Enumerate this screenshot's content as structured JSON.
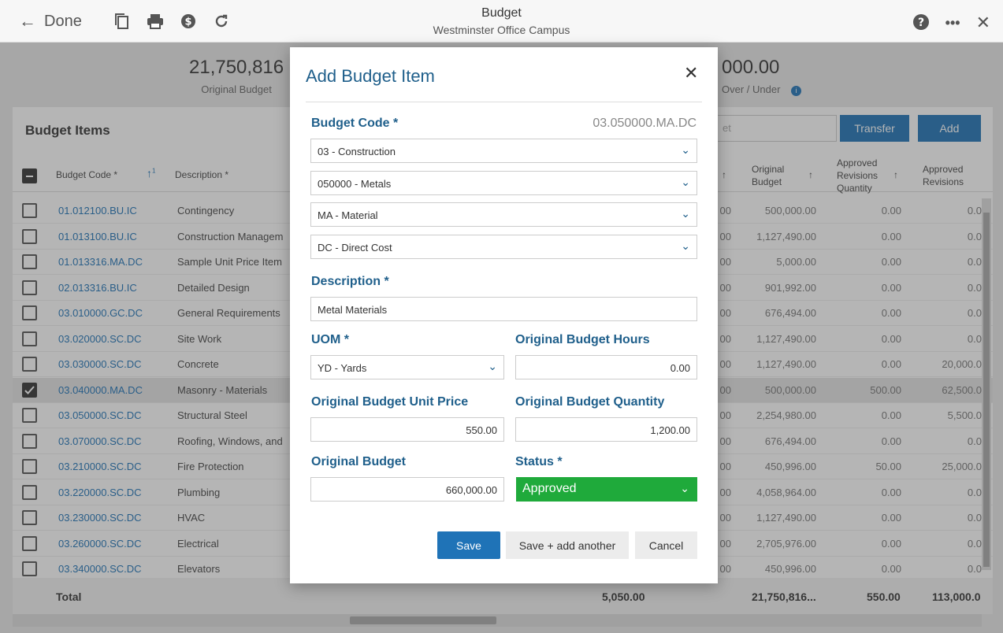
{
  "topbar": {
    "back_label": "Done",
    "title": "Budget",
    "subtitle": "Westminster Office Campus",
    "icons": [
      "copy-icon",
      "print-icon",
      "dollar-icon",
      "refresh-icon",
      "help-icon",
      "more-icon",
      "close-icon"
    ]
  },
  "summary": {
    "original_budget_value": "21,750,816",
    "original_budget_label": "Original Budget",
    "over_under_value": "000.00",
    "over_under_label": "Over / Under"
  },
  "panel": {
    "title": "Budget Items",
    "search_placeholder": "et",
    "transfer_label": "Transfer",
    "add_label": "Add",
    "columns": {
      "budget_code": "Budget Code *",
      "sort_number": "1",
      "description": "Description *",
      "original_budget": "Original Budget",
      "approved_revisions_qty": "Approved Revisions Quantity",
      "approved_revisions": "Approved Revisions"
    },
    "rows": [
      {
        "code": "01.012100.BU.IC",
        "desc": "Contingency",
        "c1": "00",
        "c2": "500,000.00",
        "c3": "0.00",
        "c4": "0.0"
      },
      {
        "code": "01.013100.BU.IC",
        "desc": "Construction Managem",
        "c1": "00",
        "c2": "1,127,490.00",
        "c3": "0.00",
        "c4": "0.0"
      },
      {
        "code": "01.013316.MA.DC",
        "desc": "Sample Unit Price Item",
        "c1": "00",
        "c2": "5,000.00",
        "c3": "0.00",
        "c4": "0.0"
      },
      {
        "code": "02.013316.BU.IC",
        "desc": "Detailed Design",
        "c1": "00",
        "c2": "901,992.00",
        "c3": "0.00",
        "c4": "0.0"
      },
      {
        "code": "03.010000.GC.DC",
        "desc": "General Requirements",
        "c1": "00",
        "c2": "676,494.00",
        "c3": "0.00",
        "c4": "0.0"
      },
      {
        "code": "03.020000.SC.DC",
        "desc": "Site Work",
        "c1": "00",
        "c2": "1,127,490.00",
        "c3": "0.00",
        "c4": "0.0"
      },
      {
        "code": "03.030000.SC.DC",
        "desc": "Concrete",
        "c1": "00",
        "c2": "1,127,490.00",
        "c3": "0.00",
        "c4": "20,000.0"
      },
      {
        "code": "03.040000.MA.DC",
        "desc": "Masonry - Materials",
        "c1": "00",
        "c2": "500,000.00",
        "c3": "500.00",
        "c4": "62,500.0"
      },
      {
        "code": "03.050000.SC.DC",
        "desc": "Structural Steel",
        "c1": "00",
        "c2": "2,254,980.00",
        "c3": "0.00",
        "c4": "5,500.0"
      },
      {
        "code": "03.070000.SC.DC",
        "desc": "Roofing, Windows, and",
        "c1": "00",
        "c2": "676,494.00",
        "c3": "0.00",
        "c4": "0.0"
      },
      {
        "code": "03.210000.SC.DC",
        "desc": "Fire Protection",
        "c1": "00",
        "c2": "450,996.00",
        "c3": "50.00",
        "c4": "25,000.0"
      },
      {
        "code": "03.220000.SC.DC",
        "desc": "Plumbing",
        "c1": "00",
        "c2": "4,058,964.00",
        "c3": "0.00",
        "c4": "0.0"
      },
      {
        "code": "03.230000.SC.DC",
        "desc": "HVAC",
        "c1": "00",
        "c2": "1,127,490.00",
        "c3": "0.00",
        "c4": "0.0"
      },
      {
        "code": "03.260000.SC.DC",
        "desc": "Electrical",
        "c1": "00",
        "c2": "2,705,976.00",
        "c3": "0.00",
        "c4": "0.0"
      },
      {
        "code": "03.340000.SC.DC",
        "desc": "Elevators",
        "c1": "00",
        "c2": "450,996.00",
        "c3": "0.00",
        "c4": "0.0"
      }
    ],
    "footer": {
      "label": "Total",
      "t1": "5,050.00",
      "t2": "21,750,816...",
      "t3": "550.00",
      "t4": "113,000.0"
    }
  },
  "modal": {
    "title": "Add Budget Item",
    "budget_code_label": "Budget Code *",
    "budget_code_value": "03.050000.MA.DC",
    "selects": [
      "03 - Construction",
      "050000 - Metals",
      "MA - Material",
      "DC - Direct Cost"
    ],
    "description_label": "Description *",
    "description_value": "Metal Materials",
    "uom_label": "UOM *",
    "uom_value": "YD - Yards",
    "hours_label": "Original Budget Hours",
    "hours_value": "0.00",
    "unit_price_label": "Original Budget Unit Price",
    "unit_price_value": "550.00",
    "quantity_label": "Original Budget Quantity",
    "quantity_value": "1,200.00",
    "original_budget_label": "Original Budget",
    "original_budget_value": "660,000.00",
    "status_label": "Status *",
    "status_value": "Approved",
    "save_label": "Save",
    "save_add_label": "Save + add another",
    "cancel_label": "Cancel"
  },
  "colors": {
    "accent": "#1f73b7",
    "heading": "#1f5f8b",
    "status_approved": "#1faa3b"
  }
}
